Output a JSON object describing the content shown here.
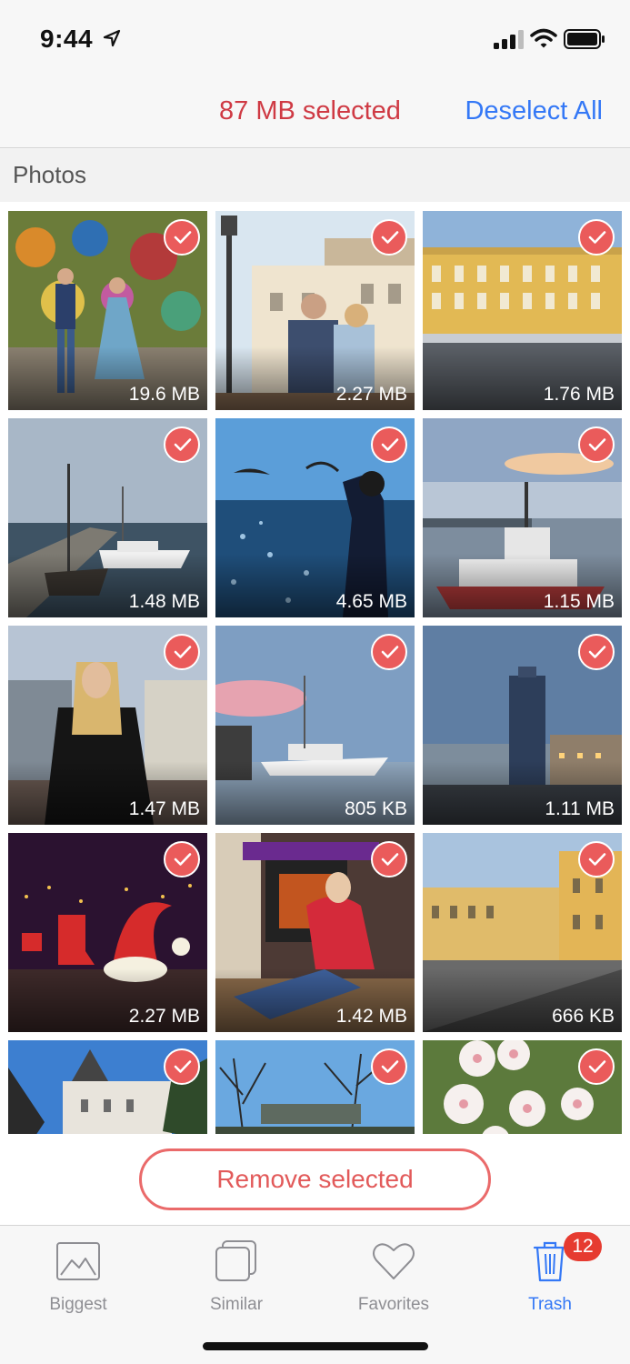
{
  "status_bar": {
    "time": "9:44"
  },
  "nav": {
    "selected_text": "87 MB selected",
    "deselect_label": "Deselect All"
  },
  "section": {
    "title": "Photos"
  },
  "photos": [
    {
      "size": "19.6 MB",
      "selected": true,
      "subject": "couple at graffiti wall"
    },
    {
      "size": "2.27 MB",
      "selected": true,
      "subject": "couple by street lamp"
    },
    {
      "size": "1.76 MB",
      "selected": true,
      "subject": "yellow building"
    },
    {
      "size": "1.48 MB",
      "selected": true,
      "subject": "pier with boats"
    },
    {
      "size": "4.65 MB",
      "selected": true,
      "subject": "woman feeding seagulls"
    },
    {
      "size": "1.15 MB",
      "selected": true,
      "subject": "tugboat at sunset"
    },
    {
      "size": "1.47 MB",
      "selected": true,
      "subject": "woman at harbor"
    },
    {
      "size": "805 KB",
      "selected": true,
      "subject": "white yacht"
    },
    {
      "size": "1.11 MB",
      "selected": true,
      "subject": "tall building at dusk"
    },
    {
      "size": "2.27 MB",
      "selected": true,
      "subject": "christmas lights at night"
    },
    {
      "size": "1.42 MB",
      "selected": true,
      "subject": "woman by fireplace"
    },
    {
      "size": "666 KB",
      "selected": true,
      "subject": "square with yellow buildings"
    },
    {
      "size": "",
      "selected": true,
      "subject": "white castle"
    },
    {
      "size": "",
      "selected": true,
      "subject": "trees and monument"
    },
    {
      "size": "",
      "selected": true,
      "subject": "blossoms"
    }
  ],
  "remove_label": "Remove selected",
  "tabs": [
    {
      "label": "Biggest",
      "icon": "image-icon",
      "active": false
    },
    {
      "label": "Similar",
      "icon": "stacked-squares-icon",
      "active": false
    },
    {
      "label": "Favorites",
      "icon": "heart-icon",
      "active": false
    },
    {
      "label": "Trash",
      "icon": "trash-icon",
      "active": true
    }
  ],
  "trash_badge": "12",
  "colors": {
    "accent": "#3478f6",
    "danger": "#ea5b5b",
    "selected_text": "#cf3a44",
    "badge": "#e63b30"
  }
}
